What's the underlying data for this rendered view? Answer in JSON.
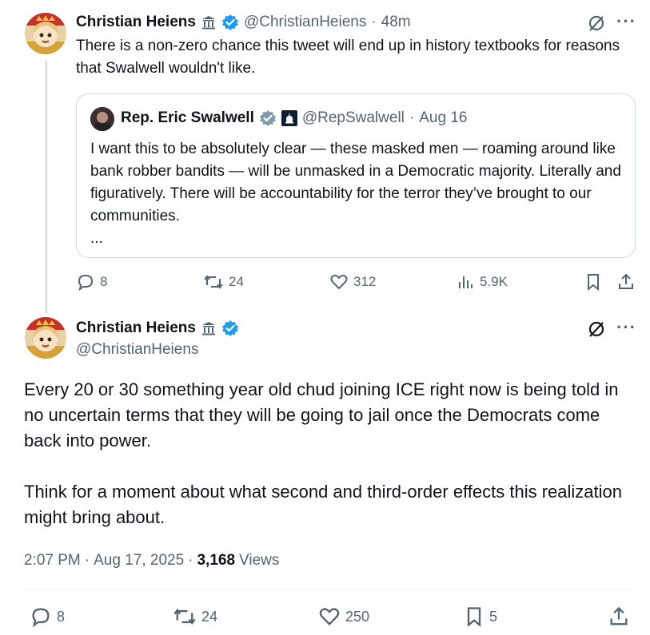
{
  "tweet1": {
    "name": "Christian Heiens",
    "handle": "@ChristianHeiens",
    "sep": "·",
    "time": "48m",
    "text": "There is a non-zero chance this tweet will end up in history textbooks for reasons that Swalwell wouldn't like.",
    "quote": {
      "name": "Rep. Eric Swalwell",
      "handle": "@RepSwalwell",
      "sep": "·",
      "date": "Aug 16",
      "text": "I want this to be absolutely clear — these masked men — roaming around like bank robber bandits — will be unmasked in a Democratic majority.  Literally and figuratively.  There will be accountability for the terror they’ve brought to our communities.",
      "ellipsis": "..."
    },
    "actions": {
      "replies": "8",
      "reposts": "24",
      "likes": "312",
      "views": "5.9K"
    }
  },
  "tweet2": {
    "name": "Christian Heiens",
    "handle": "@ChristianHeiens",
    "paragraph1": "Every 20 or 30 something year old chud joining ICE right now is being told in no uncertain terms that they will be going to jail once the Democrats come back into power.",
    "paragraph2": "Think for a moment about what second and third-order effects this realization might bring about.",
    "meta": {
      "time": "2:07 PM",
      "sep1": "·",
      "date": "Aug 17, 2025",
      "sep2": "·",
      "views_count": "3,168",
      "views_label": "Views"
    },
    "actions": {
      "replies": "8",
      "reposts": "24",
      "likes": "250",
      "bookmarks": "5"
    }
  },
  "colors": {
    "verified": "#1d9bf0",
    "gov_badge": "#829aab",
    "text": "#0f1419",
    "secondary": "#536471",
    "border": "#cfd9de"
  }
}
